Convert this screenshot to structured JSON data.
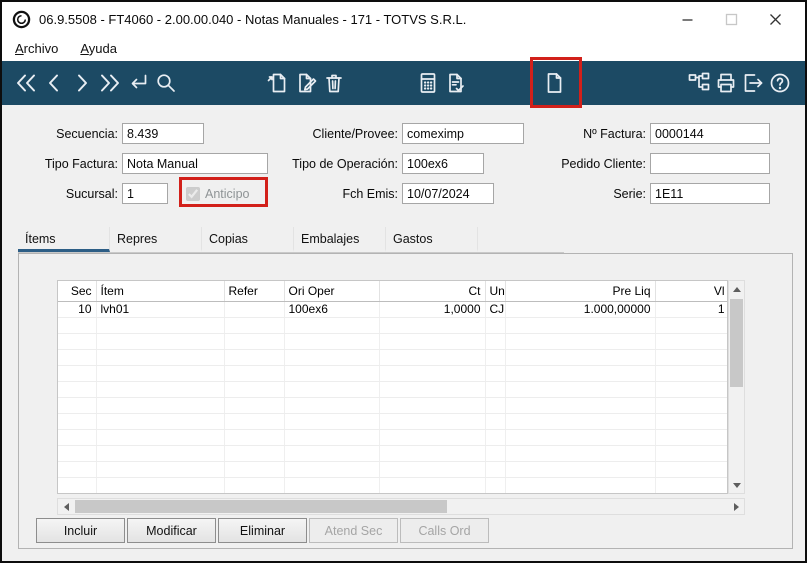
{
  "window": {
    "title": "06.9.5508 - FT4060 - 2.00.00.040 - Notas Manuales - 171 - TOTVS S.R.L.",
    "controls": [
      "minimize",
      "maximize",
      "close"
    ]
  },
  "menu": {
    "items": [
      {
        "label": "Archivo"
      },
      {
        "label": "Ayuda"
      }
    ]
  },
  "toolbar": {
    "background": "#1c4a64",
    "icons": [
      "first-record-icon",
      "previous-icon",
      "next-icon",
      "last-icon",
      "enter-icon",
      "search-icon",
      "new-document-icon",
      "edit-document-icon",
      "delete-icon",
      "calculator-icon",
      "document-check-icon",
      "blank-document-icon",
      "tree-icon",
      "print-icon",
      "exit-icon",
      "help-icon"
    ]
  },
  "highlights": {
    "color": "#d2201a",
    "items": [
      "blank-document-icon",
      "anticipo-checkbox"
    ]
  },
  "form": {
    "secuencia": {
      "label": "Secuencia:",
      "value": "8.439"
    },
    "cliente_provee": {
      "label": "Cliente/Provee:",
      "value": "comeximp"
    },
    "num_factura": {
      "label": "Nº Factura:",
      "value": "0000144"
    },
    "tipo_factura": {
      "label": "Tipo Factura:",
      "value": "Nota Manual"
    },
    "tipo_operacion": {
      "label": "Tipo de Operación:",
      "value": "100ex6"
    },
    "pedido_cliente": {
      "label": "Pedido Cliente:",
      "value": ""
    },
    "sucursal": {
      "label": "Sucursal:",
      "value": "1"
    },
    "anticipo": {
      "label": "Anticipo",
      "checked": true,
      "disabled": true
    },
    "fch_emis": {
      "label": "Fch Emis:",
      "value": "10/07/2024"
    },
    "serie": {
      "label": "Serie:",
      "value": "1E11"
    }
  },
  "tabs": [
    {
      "label": "Ítems",
      "active": true
    },
    {
      "label": "Repres",
      "active": false
    },
    {
      "label": "Copias",
      "active": false
    },
    {
      "label": "Embalajes",
      "active": false
    },
    {
      "label": "Gastos",
      "active": false
    }
  ],
  "table": {
    "columns": [
      {
        "label": "Sec",
        "align": "right"
      },
      {
        "label": "Ítem",
        "align": "left"
      },
      {
        "label": "Refer",
        "align": "left"
      },
      {
        "label": "Ori Oper",
        "align": "left"
      },
      {
        "label": "Ct",
        "align": "right"
      },
      {
        "label": "Un",
        "align": "left"
      },
      {
        "label": "Pre Liq",
        "align": "right"
      },
      {
        "label": "Vl",
        "align": "right"
      }
    ],
    "rows": [
      [
        "10",
        "lvh01",
        "",
        "100ex6",
        "1,0000",
        "CJ",
        "1.000,00000",
        "1"
      ]
    ],
    "empty_rows": 11
  },
  "actions": [
    {
      "label": "Incluir",
      "enabled": true
    },
    {
      "label": "Modificar",
      "enabled": true
    },
    {
      "label": "Eliminar",
      "enabled": true
    },
    {
      "label": "Atend Sec",
      "enabled": false
    },
    {
      "label": "Calls Ord",
      "enabled": false
    }
  ],
  "colors": {
    "toolbar_bg": "#1c4a64",
    "highlight_red": "#d2201a",
    "active_tab_underline": "#2d5e86"
  }
}
